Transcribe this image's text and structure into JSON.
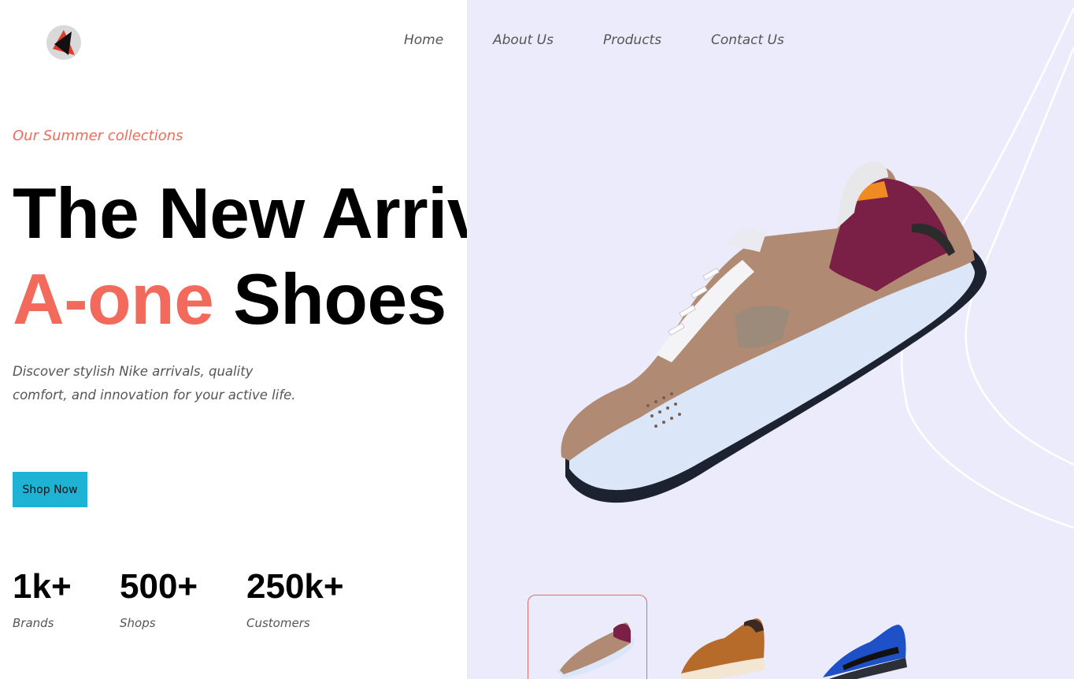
{
  "nav": {
    "links": [
      "Home",
      "About Us",
      "Products",
      "Contact Us"
    ]
  },
  "hero": {
    "kicker": "Our Summer collections",
    "title_line1": "The New Arrival",
    "title_accent": "A-one",
    "title_rest": "Shoes",
    "description": "Discover stylish Nike arrivals, quality comfort, and innovation for your active life.",
    "cta_label": "Shop Now"
  },
  "stats": [
    {
      "value": "1k+",
      "label": "Brands"
    },
    {
      "value": "500+",
      "label": "Shops"
    },
    {
      "value": "250k+",
      "label": "Customers"
    }
  ],
  "thumbnails": {
    "items": [
      "beige-purple-sneaker",
      "brown-leather-sneaker",
      "blue-black-sneaker"
    ],
    "active_index": 0
  },
  "colors": {
    "accent": "#f26a5b",
    "cta": "#1eb3d4",
    "panel_bg": "#ebebfc",
    "active_thumb_border": "#e36a6a"
  }
}
